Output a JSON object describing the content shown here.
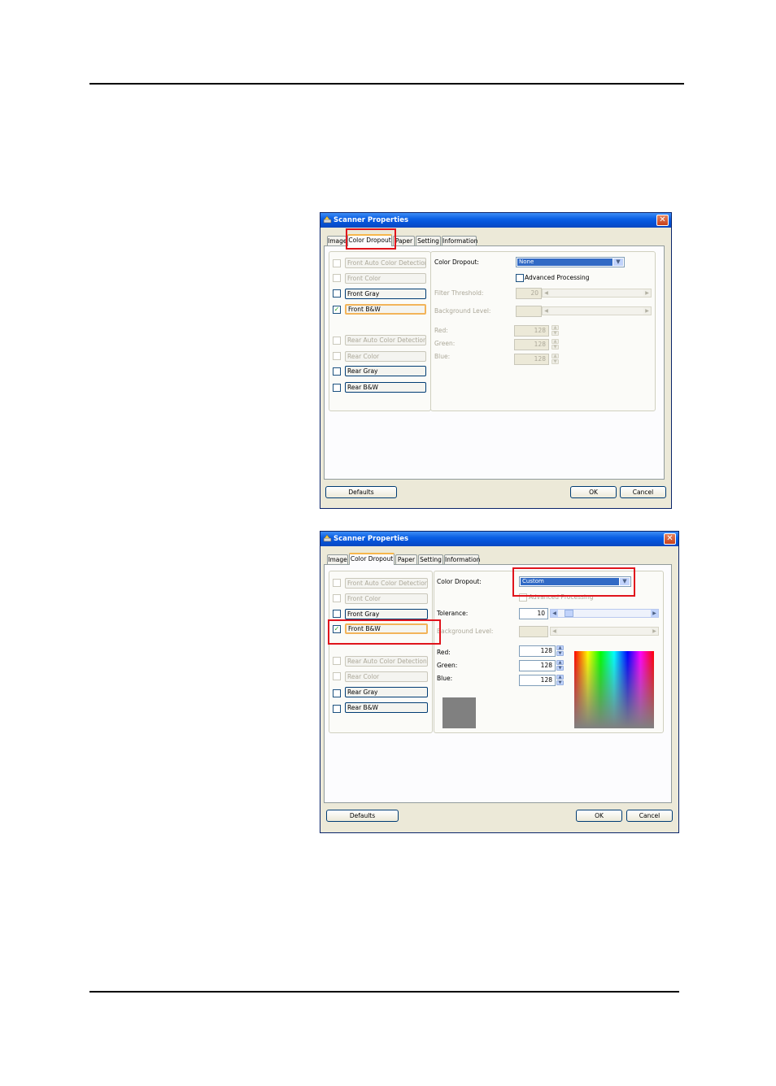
{
  "dialog_top": {
    "title": "Scanner Properties",
    "tabs": [
      "Image",
      "Color Dropout",
      "Paper",
      "Setting",
      "Information"
    ],
    "active_tab": "Color Dropout",
    "left_options": [
      {
        "label": "Front Auto Color Detection",
        "checked": false,
        "enabled": false
      },
      {
        "label": "Front Color",
        "checked": false,
        "enabled": false
      },
      {
        "label": "Front Gray",
        "checked": false,
        "enabled": true
      },
      {
        "label": "Front B&W",
        "checked": true,
        "enabled": true
      },
      {
        "label": "Rear Auto Color Detection",
        "checked": false,
        "enabled": false
      },
      {
        "label": "Rear Color",
        "checked": false,
        "enabled": false
      },
      {
        "label": "Rear Gray",
        "checked": false,
        "enabled": true
      },
      {
        "label": "Rear B&W",
        "checked": false,
        "enabled": true
      }
    ],
    "color_dropout_label": "Color Dropout:",
    "color_dropout_value": "None",
    "advanced_processing": "Advanced Processing",
    "filter_threshold_label": "Filter Threshold:",
    "filter_threshold_value": "20",
    "background_level_label": "Background Level:",
    "red_label": "Red:",
    "green_label": "Green:",
    "blue_label": "Blue:",
    "red_value": "128",
    "green_value": "128",
    "blue_value": "128",
    "defaults": "Defaults",
    "ok": "OK",
    "cancel": "Cancel"
  },
  "dialog_bottom": {
    "title": "Scanner Properties",
    "tabs": [
      "Image",
      "Color Dropout",
      "Paper",
      "Setting",
      "Information"
    ],
    "active_tab": "Color Dropout",
    "left_options": [
      {
        "label": "Front Auto Color Detection",
        "checked": false,
        "enabled": false
      },
      {
        "label": "Front Color",
        "checked": false,
        "enabled": false
      },
      {
        "label": "Front Gray",
        "checked": false,
        "enabled": true
      },
      {
        "label": "Front B&W",
        "checked": true,
        "enabled": true
      },
      {
        "label": "Rear Auto Color Detection",
        "checked": false,
        "enabled": false
      },
      {
        "label": "Rear Color",
        "checked": false,
        "enabled": false
      },
      {
        "label": "Rear Gray",
        "checked": false,
        "enabled": true
      },
      {
        "label": "Rear B&W",
        "checked": false,
        "enabled": true
      }
    ],
    "color_dropout_label": "Color Dropout:",
    "color_dropout_value": "Custom",
    "advanced_processing": "Advanced Processing",
    "tolerance_label": "Tolerance:",
    "tolerance_value": "10",
    "background_level_label": "Background Level:",
    "red_label": "Red:",
    "green_label": "Green:",
    "blue_label": "Blue:",
    "red_value": "128",
    "green_value": "128",
    "blue_value": "128",
    "swatch_color": "#808080",
    "defaults": "Defaults",
    "ok": "OK",
    "cancel": "Cancel"
  },
  "colors": {
    "highlight": "#e0141c",
    "titlebar": "#0b5fe4",
    "dialog_bg": "#ece9d8",
    "selection": "#316ac5"
  },
  "icons": [
    "scanner-icon",
    "close-icon",
    "checkmark-icon",
    "dropdown-arrow-icon",
    "spin-up-icon",
    "spin-down-icon",
    "slider-left-icon",
    "slider-right-icon"
  ]
}
